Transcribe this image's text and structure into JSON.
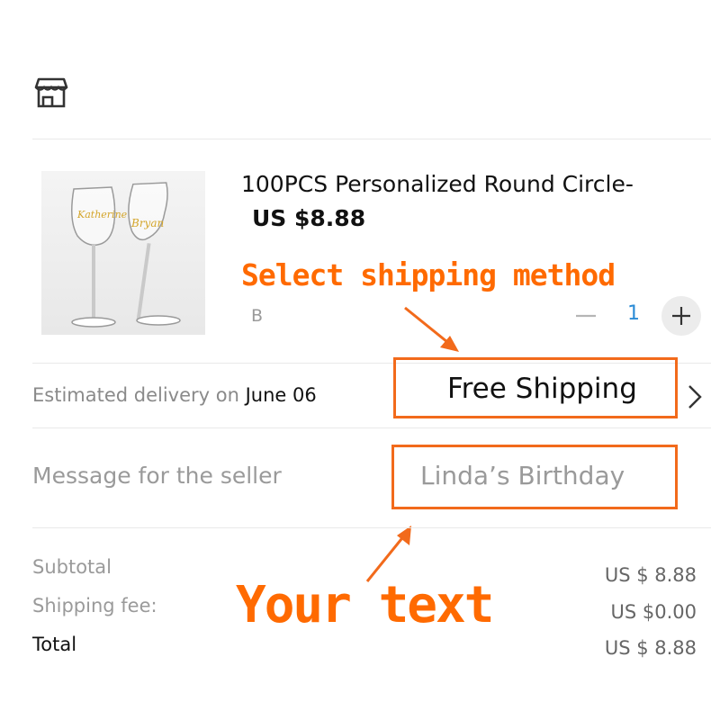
{
  "store": {
    "icon": "store-icon"
  },
  "product": {
    "title": "100PCS Personalized Round Circle-",
    "price": "US $8.88",
    "sku": "B",
    "image_name_1": "Katherine",
    "image_name_2": "Bryan",
    "quantity": "1"
  },
  "annotations": {
    "select_shipping": "Select shipping method",
    "your_text": "Your text"
  },
  "delivery": {
    "label": "Estimated delivery on ",
    "date": "June 06",
    "shipping_method": "Free Shipping"
  },
  "message": {
    "label": "Message for the seller",
    "value": "Linda’s Birthday"
  },
  "summary": {
    "subtotal_label": "Subtotal",
    "subtotal_value": "US $ 8.88",
    "shipping_label": "Shipping fee:",
    "shipping_value": "US $0.00",
    "total_label": "Total",
    "total_value": "US $ 8.88"
  },
  "colors": {
    "annotation": "#ff6a00",
    "highlight_border": "#f26a1b",
    "quantity": "#2a8bd6"
  }
}
